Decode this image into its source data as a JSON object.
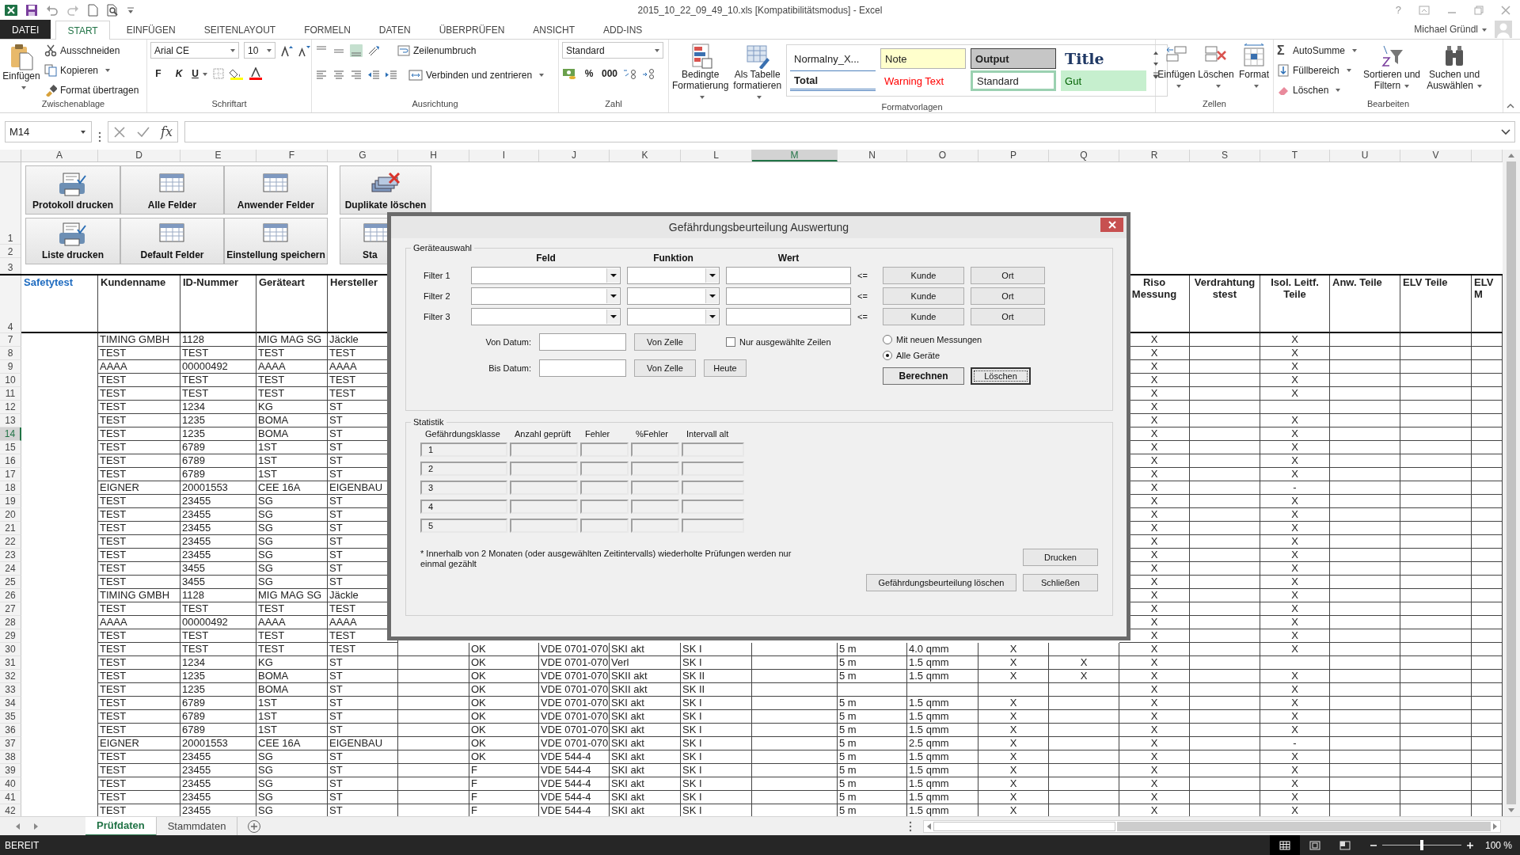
{
  "title_bar": {
    "title": "2015_10_22_09_49_10.xls  [Kompatibilitätsmodus] - Excel",
    "help": "?",
    "user": "Michael Gründl"
  },
  "ribbon_tabs": [
    {
      "label": "DATEI",
      "kind": "file",
      "selected": false
    },
    {
      "label": "START",
      "kind": "tab",
      "selected": true
    },
    {
      "label": "EINFÜGEN",
      "kind": "tab",
      "selected": false
    },
    {
      "label": "SEITENLAYOUT",
      "kind": "tab",
      "selected": false
    },
    {
      "label": "FORMELN",
      "kind": "tab",
      "selected": false
    },
    {
      "label": "DATEN",
      "kind": "tab",
      "selected": false
    },
    {
      "label": "ÜBERPRÜFEN",
      "kind": "tab",
      "selected": false
    },
    {
      "label": "ANSICHT",
      "kind": "tab",
      "selected": false
    },
    {
      "label": "ADD-INS",
      "kind": "tab",
      "selected": false
    }
  ],
  "ribbon": [
    {
      "kind": "clipboard",
      "title": "Zwischenablage",
      "paste": "Einfügen",
      "items": [
        "Ausschneiden",
        "Kopieren",
        "Format übertragen"
      ]
    },
    {
      "kind": "font",
      "title": "Schriftart",
      "font": "Arial CE",
      "size": "10",
      "bold": "F",
      "italic": "K",
      "underline": "U"
    },
    {
      "kind": "alignment",
      "title": "Ausrichtung",
      "wrap": "Zeilenumbruch",
      "merge": "Verbinden und zentrieren",
      "vertical_align": [
        {
          "selected": false
        },
        {
          "selected": false
        },
        {
          "selected": true
        }
      ]
    },
    {
      "kind": "number",
      "title": "Zahl",
      "format": "Standard",
      "percent": "%",
      "thousands": "000"
    },
    {
      "kind": "styles",
      "title": "Formatvorlagen",
      "conditional": "Bedingte Formatierung",
      "as_table": "Als Tabelle formatieren",
      "styles": [
        {
          "label": "Normalny_X...",
          "kind": "normal",
          "selected": false
        },
        {
          "label": "Note",
          "kind": "note",
          "selected": false
        },
        {
          "label": "Output",
          "kind": "output",
          "selected": false
        },
        {
          "label": "Title",
          "kind": "title",
          "selected": false
        },
        {
          "label": "Total",
          "kind": "total",
          "selected": false
        },
        {
          "label": "Warning Text",
          "kind": "warning",
          "selected": false
        },
        {
          "label": "Standard",
          "kind": "standard",
          "selected": true
        },
        {
          "label": "Gut",
          "kind": "good",
          "selected": false
        }
      ]
    },
    {
      "kind": "cells",
      "title": "Zellen",
      "buttons": [
        {
          "label": "Einfügen",
          "kind": "insert"
        },
        {
          "label": "Löschen",
          "kind": "delete"
        },
        {
          "label": "Format",
          "kind": "format"
        }
      ]
    },
    {
      "kind": "editing",
      "title": "Bearbeiten",
      "sum_icon": "Σ",
      "items": [
        "AutoSumme",
        "Füllbereich",
        "Löschen"
      ],
      "sort": "Sortieren und Filtern",
      "find": "Suchen und Auswählen"
    }
  ],
  "formula_bar": {
    "name_box": "M14",
    "function_button": "fx"
  },
  "columns": [
    {
      "label": "A",
      "selected": false
    },
    {
      "label": "D",
      "selected": false
    },
    {
      "label": "E",
      "selected": false
    },
    {
      "label": "F",
      "selected": false
    },
    {
      "label": "G",
      "selected": false
    },
    {
      "label": "H",
      "selected": false
    },
    {
      "label": "I",
      "selected": false
    },
    {
      "label": "J",
      "selected": false
    },
    {
      "label": "K",
      "selected": false
    },
    {
      "label": "L",
      "selected": false
    },
    {
      "label": "M",
      "selected": true
    },
    {
      "label": "N",
      "selected": false
    },
    {
      "label": "O",
      "selected": false
    },
    {
      "label": "P",
      "selected": false
    },
    {
      "label": "Q",
      "selected": false
    },
    {
      "label": "R",
      "selected": false
    },
    {
      "label": "S",
      "selected": false
    },
    {
      "label": "T",
      "selected": false
    },
    {
      "label": "U",
      "selected": false
    },
    {
      "label": "V",
      "selected": false
    },
    {
      "selected": false
    }
  ],
  "sheet_buttons": {
    "row_numbers": [
      "1",
      "2",
      "3"
    ],
    "buttons": [
      {
        "label": "Protokoll drucken",
        "kind": "print"
      },
      {
        "label": "Alle Felder",
        "kind": "sum"
      },
      {
        "label": "Anwender Felder",
        "kind": "heart"
      },
      {
        "label": "Duplikate löschen",
        "kind": "delete"
      },
      {
        "label": "Liste drucken",
        "kind": "print"
      },
      {
        "label": "Default Felder",
        "kind": "star"
      },
      {
        "label": "Einstellung speichern",
        "kind": "disk"
      },
      {
        "label": "Sta",
        "kind": "table"
      }
    ]
  },
  "header_row": {
    "number": "4",
    "cells": [
      "Safetytest",
      "Kundenname",
      "ID-Nummer",
      "Geräteart",
      "Hersteller",
      null,
      null,
      null,
      null,
      null,
      null,
      null,
      null,
      null,
      null,
      "Riso Messung",
      "Verdrahtungstest",
      "Isol. Leitf. Teile",
      "Anw. Teile",
      "ELV Teile",
      "ELV M"
    ]
  },
  "rows": [
    {
      "number": "7",
      "selected": false,
      "cells": [
        null,
        "TIMING GMBH",
        "1128",
        "MIG MAG SG",
        "Jäckle",
        null,
        null,
        null,
        null,
        null,
        null,
        null,
        null,
        null,
        null,
        "X",
        null,
        "X",
        null,
        null,
        null
      ]
    },
    {
      "number": "8",
      "selected": false,
      "cells": [
        null,
        "TEST",
        "TEST",
        "TEST",
        "TEST",
        null,
        null,
        null,
        null,
        null,
        null,
        null,
        null,
        null,
        null,
        "X",
        null,
        "X",
        null,
        null,
        null
      ]
    },
    {
      "number": "9",
      "selected": false,
      "cells": [
        null,
        "AAAA",
        "00000492",
        "AAAA",
        "AAAA",
        null,
        null,
        null,
        null,
        null,
        null,
        null,
        null,
        null,
        null,
        "X",
        null,
        "X",
        null,
        null,
        null
      ]
    },
    {
      "number": "10",
      "selected": false,
      "cells": [
        null,
        "TEST",
        "TEST",
        "TEST",
        "TEST",
        null,
        null,
        null,
        null,
        null,
        null,
        null,
        null,
        null,
        null,
        "X",
        null,
        "X",
        null,
        null,
        null
      ]
    },
    {
      "number": "11",
      "selected": false,
      "cells": [
        null,
        "TEST",
        "TEST",
        "TEST",
        "TEST",
        null,
        null,
        null,
        null,
        null,
        null,
        null,
        null,
        null,
        null,
        "X",
        null,
        "X",
        null,
        null,
        null
      ]
    },
    {
      "number": "12",
      "selected": false,
      "cells": [
        null,
        "TEST",
        "1234",
        "KG",
        "ST",
        null,
        null,
        null,
        null,
        null,
        null,
        null,
        null,
        null,
        null,
        "X",
        null,
        null,
        null,
        null,
        null
      ]
    },
    {
      "number": "13",
      "selected": false,
      "cells": [
        null,
        "TEST",
        "1235",
        "BOMA",
        "ST",
        null,
        null,
        null,
        null,
        null,
        null,
        null,
        null,
        null,
        null,
        "X",
        null,
        "X",
        null,
        null,
        null
      ]
    },
    {
      "number": "14",
      "selected": true,
      "cells": [
        null,
        "TEST",
        "1235",
        "BOMA",
        "ST",
        null,
        null,
        null,
        null,
        null,
        null,
        null,
        null,
        null,
        null,
        "X",
        null,
        "X",
        null,
        null,
        null
      ]
    },
    {
      "number": "15",
      "selected": false,
      "cells": [
        null,
        "TEST",
        "6789",
        "1ST",
        "ST",
        null,
        null,
        null,
        null,
        null,
        null,
        null,
        null,
        null,
        null,
        "X",
        null,
        "X",
        null,
        null,
        null
      ]
    },
    {
      "number": "16",
      "selected": false,
      "cells": [
        null,
        "TEST",
        "6789",
        "1ST",
        "ST",
        null,
        null,
        null,
        null,
        null,
        null,
        null,
        null,
        null,
        null,
        "X",
        null,
        "X",
        null,
        null,
        null
      ]
    },
    {
      "number": "17",
      "selected": false,
      "cells": [
        null,
        "TEST",
        "6789",
        "1ST",
        "ST",
        null,
        null,
        null,
        null,
        null,
        null,
        null,
        null,
        null,
        null,
        "X",
        null,
        "X",
        null,
        null,
        null
      ]
    },
    {
      "number": "18",
      "selected": false,
      "cells": [
        null,
        "EIGNER",
        "20001553",
        "CEE 16A",
        "EIGENBAU",
        null,
        null,
        null,
        null,
        null,
        null,
        null,
        null,
        null,
        null,
        "X",
        null,
        "-",
        null,
        null,
        null
      ]
    },
    {
      "number": "19",
      "selected": false,
      "cells": [
        null,
        "TEST",
        "23455",
        "SG",
        "ST",
        null,
        null,
        null,
        null,
        null,
        null,
        null,
        null,
        null,
        null,
        "X",
        null,
        "X",
        null,
        null,
        null
      ]
    },
    {
      "number": "20",
      "selected": false,
      "cells": [
        null,
        "TEST",
        "23455",
        "SG",
        "ST",
        null,
        null,
        null,
        null,
        null,
        null,
        null,
        null,
        null,
        null,
        "X",
        null,
        "X",
        null,
        null,
        null
      ]
    },
    {
      "number": "21",
      "selected": false,
      "cells": [
        null,
        "TEST",
        "23455",
        "SG",
        "ST",
        null,
        null,
        null,
        null,
        null,
        null,
        null,
        null,
        null,
        null,
        "X",
        null,
        "X",
        null,
        null,
        null
      ]
    },
    {
      "number": "22",
      "selected": false,
      "cells": [
        null,
        "TEST",
        "23455",
        "SG",
        "ST",
        null,
        null,
        null,
        null,
        null,
        null,
        null,
        null,
        null,
        null,
        "X",
        null,
        "X",
        null,
        null,
        null
      ]
    },
    {
      "number": "23",
      "selected": false,
      "cells": [
        null,
        "TEST",
        "23455",
        "SG",
        "ST",
        null,
        null,
        null,
        null,
        null,
        null,
        null,
        null,
        null,
        null,
        "X",
        null,
        "X",
        null,
        null,
        null
      ]
    },
    {
      "number": "24",
      "selected": false,
      "cells": [
        null,
        "TEST",
        "3455",
        "SG",
        "ST",
        null,
        null,
        null,
        null,
        null,
        null,
        null,
        null,
        null,
        null,
        "X",
        null,
        "X",
        null,
        null,
        null
      ]
    },
    {
      "number": "25",
      "selected": false,
      "cells": [
        null,
        "TEST",
        "3455",
        "SG",
        "ST",
        null,
        null,
        null,
        null,
        null,
        null,
        null,
        null,
        null,
        null,
        "X",
        null,
        "X",
        null,
        null,
        null
      ]
    },
    {
      "number": "26",
      "selected": false,
      "cells": [
        null,
        "TIMING GMBH",
        "1128",
        "MIG MAG SG",
        "Jäckle",
        null,
        null,
        null,
        null,
        null,
        null,
        null,
        null,
        null,
        null,
        "X",
        null,
        "X",
        null,
        null,
        null
      ]
    },
    {
      "number": "27",
      "selected": false,
      "cells": [
        null,
        "TEST",
        "TEST",
        "TEST",
        "TEST",
        null,
        null,
        null,
        null,
        null,
        null,
        null,
        null,
        null,
        null,
        "X",
        null,
        "X",
        null,
        null,
        null
      ]
    },
    {
      "number": "28",
      "selected": false,
      "cells": [
        null,
        "AAAA",
        "00000492",
        "AAAA",
        "AAAA",
        null,
        null,
        null,
        null,
        null,
        null,
        null,
        null,
        null,
        null,
        "X",
        null,
        "X",
        null,
        null,
        null
      ]
    },
    {
      "number": "29",
      "selected": false,
      "cells": [
        null,
        "TEST",
        "TEST",
        "TEST",
        "TEST",
        null,
        null,
        null,
        null,
        null,
        null,
        null,
        null,
        null,
        null,
        "X",
        null,
        "X",
        null,
        null,
        null
      ]
    },
    {
      "number": "30",
      "selected": false,
      "cells": [
        null,
        "TEST",
        "TEST",
        "TEST",
        "TEST",
        null,
        "OK",
        "VDE 0701-070",
        "SKI akt",
        "SK I",
        null,
        "5 m",
        "4.0 qmm",
        "X",
        null,
        "X",
        null,
        "X",
        null,
        null,
        null
      ]
    },
    {
      "number": "31",
      "selected": false,
      "cells": [
        null,
        "TEST",
        "1234",
        "KG",
        "ST",
        null,
        "OK",
        "VDE 0701-070",
        "Verl",
        "SK I",
        null,
        "5 m",
        "1.5 qmm",
        "X",
        "X",
        "X",
        null,
        null,
        null,
        null,
        null
      ]
    },
    {
      "number": "32",
      "selected": false,
      "cells": [
        null,
        "TEST",
        "1235",
        "BOMA",
        "ST",
        null,
        "OK",
        "VDE 0701-070",
        "SKII akt",
        "SK II",
        null,
        "5 m",
        "1.5 qmm",
        "X",
        "X",
        "X",
        null,
        "X",
        null,
        null,
        null
      ]
    },
    {
      "number": "33",
      "selected": false,
      "cells": [
        null,
        "TEST",
        "1235",
        "BOMA",
        "ST",
        null,
        "OK",
        "VDE 0701-070",
        "SKII akt",
        "SK II",
        null,
        null,
        null,
        null,
        null,
        "X",
        null,
        "X",
        null,
        null,
        null
      ]
    },
    {
      "number": "34",
      "selected": false,
      "cells": [
        null,
        "TEST",
        "6789",
        "1ST",
        "ST",
        null,
        "OK",
        "VDE 0701-070",
        "SKI akt",
        "SK I",
        null,
        "5 m",
        "1.5 qmm",
        "X",
        null,
        "X",
        null,
        "X",
        null,
        null,
        null
      ]
    },
    {
      "number": "35",
      "selected": false,
      "cells": [
        null,
        "TEST",
        "6789",
        "1ST",
        "ST",
        null,
        "OK",
        "VDE 0701-070",
        "SKI akt",
        "SK I",
        null,
        "5 m",
        "1.5 qmm",
        "X",
        null,
        "X",
        null,
        "X",
        null,
        null,
        null
      ]
    },
    {
      "number": "36",
      "selected": false,
      "cells": [
        null,
        "TEST",
        "6789",
        "1ST",
        "ST",
        null,
        "OK",
        "VDE 0701-070",
        "SKI akt",
        "SK I",
        null,
        "5 m",
        "1.5 qmm",
        "X",
        null,
        "X",
        null,
        "X",
        null,
        null,
        null
      ]
    },
    {
      "number": "37",
      "selected": false,
      "cells": [
        null,
        "EIGNER",
        "20001553",
        "CEE 16A",
        "EIGENBAU",
        null,
        "OK",
        "VDE 0701-070",
        "SKI akt",
        "SK I",
        null,
        "5 m",
        "2.5 qmm",
        "X",
        null,
        "X",
        null,
        "-",
        null,
        null,
        null
      ]
    },
    {
      "number": "38",
      "selected": false,
      "cells": [
        null,
        "TEST",
        "23455",
        "SG",
        "ST",
        null,
        "OK",
        "VDE 544-4",
        "SKI akt",
        "SK I",
        null,
        "5 m",
        "1.5 qmm",
        "X",
        null,
        "X",
        null,
        "X",
        null,
        null,
        null
      ]
    },
    {
      "number": "39",
      "selected": false,
      "cells": [
        null,
        "TEST",
        "23455",
        "SG",
        "ST",
        null,
        "F",
        "VDE 544-4",
        "SKI akt",
        "SK I",
        null,
        "5 m",
        "1.5 qmm",
        "X",
        null,
        "X",
        null,
        "X",
        null,
        null,
        null
      ]
    },
    {
      "number": "40",
      "selected": false,
      "cells": [
        null,
        "TEST",
        "23455",
        "SG",
        "ST",
        null,
        "F",
        "VDE 544-4",
        "SKI akt",
        "SK I",
        null,
        "5 m",
        "1.5 qmm",
        "X",
        null,
        "X",
        null,
        "X",
        null,
        null,
        null
      ]
    },
    {
      "number": "41",
      "selected": false,
      "cells": [
        null,
        "TEST",
        "23455",
        "SG",
        "ST",
        null,
        "F",
        "VDE 544-4",
        "SKI akt",
        "SK I",
        null,
        "5 m",
        "1.5 qmm",
        "X",
        null,
        "X",
        null,
        "X",
        null,
        null,
        null
      ]
    },
    {
      "number": "42",
      "selected": false,
      "cells": [
        null,
        "TEST",
        "23455",
        "SG",
        "ST",
        null,
        "F",
        "VDE 544-4",
        "SKI akt",
        "SK I",
        null,
        "5 m",
        "1.5 qmm",
        "X",
        null,
        "X",
        null,
        "X",
        null,
        null,
        null
      ]
    }
  ],
  "dialog": {
    "title": "Gefährdungsbeurteilung Auswertung",
    "selection": {
      "title": "Geräteauswahl",
      "headers": [
        "Feld",
        "Funktion",
        "Wert"
      ],
      "filters": [
        {
          "label": "Filter 1",
          "operator": "<=",
          "buttons": [
            "Kunde",
            "Ort"
          ]
        },
        {
          "label": "Filter 2",
          "operator": "<=",
          "buttons": [
            "Kunde",
            "Ort"
          ]
        },
        {
          "label": "Filter 3",
          "operator": "<=",
          "buttons": [
            "Kunde",
            "Ort"
          ]
        }
      ],
      "dates": [
        {
          "label": "Von Datum:",
          "buttons": [
            "Von Zelle"
          ]
        },
        {
          "label": "Bis Datum:",
          "buttons": [
            "Von Zelle",
            "Heute"
          ]
        }
      ],
      "only_selected": {
        "label": "Nur ausgewählte Zeilen",
        "checked": false
      },
      "options": [
        {
          "label": "Mit neuen Messungen",
          "selected": false
        },
        {
          "label": "Alle Geräte",
          "selected": true
        }
      ],
      "actions": [
        {
          "label": "Berechnen",
          "kind": "default"
        },
        {
          "label": "Löschen",
          "kind": "focused"
        }
      ]
    },
    "statistics": {
      "title": "Statistik",
      "columns": [
        "Gefährdungsklasse",
        "Anzahl geprüft",
        "Fehler",
        "%Fehler",
        "Intervall alt"
      ],
      "rows": [
        "1",
        "2",
        "3",
        "4",
        "5"
      ],
      "note": "* Innerhalb von 2 Monaten (oder ausgewählten Zeitintervalls) wiederholte Prüfungen werden nur einmal gezählt"
    },
    "buttons": [
      {
        "label": "Drucken",
        "kind": "print"
      },
      {
        "label": "Gefährdungsbeurteilung löschen",
        "kind": "delete"
      },
      {
        "label": "Schließen",
        "kind": "close"
      }
    ]
  },
  "sheet_tabs": [
    {
      "label": "Prüfdaten",
      "selected": true
    },
    {
      "label": "Stammdaten",
      "selected": false
    }
  ],
  "status_bar": {
    "status": "BEREIT",
    "views": [
      {
        "kind": "normal",
        "selected": true
      },
      {
        "kind": "layout",
        "selected": false
      },
      {
        "kind": "pagebreak",
        "selected": false
      }
    ],
    "zoom": {
      "level": 0.5,
      "label": "100 %"
    }
  }
}
